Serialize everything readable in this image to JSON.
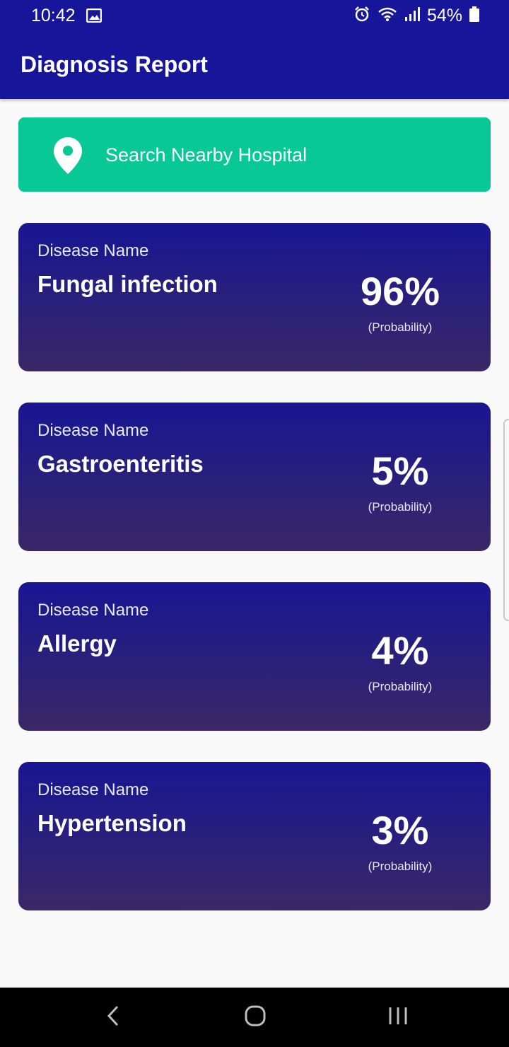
{
  "status_bar": {
    "time": "10:42",
    "battery_percent": "54%",
    "icons": [
      "gallery-icon",
      "alarm-icon",
      "wifi-icon",
      "signal-icon",
      "battery-icon"
    ]
  },
  "app_bar": {
    "title": "Diagnosis Report"
  },
  "search": {
    "label": "Search Nearby Hospital",
    "icon": "location-pin-icon",
    "color": "#08c995"
  },
  "diagnoses": [
    {
      "label": "Disease Name",
      "disease": "Fungal infection",
      "probability": "96%",
      "probability_caption": "(Probability)"
    },
    {
      "label": "Disease Name",
      "disease": "Gastroenteritis",
      "probability": "5%",
      "probability_caption": "(Probability)"
    },
    {
      "label": "Disease Name",
      "disease": "Allergy",
      "probability": "4%",
      "probability_caption": "(Probability)"
    },
    {
      "label": "Disease Name",
      "disease": "Hypertension",
      "probability": "3%",
      "probability_caption": "(Probability)"
    }
  ],
  "colors": {
    "primary": "#17169a",
    "card_top": "#181693",
    "card_bottom": "#3a2866",
    "accent": "#08c995"
  },
  "nav_bar": {
    "icons": [
      "back-icon",
      "home-icon",
      "recents-icon"
    ]
  }
}
